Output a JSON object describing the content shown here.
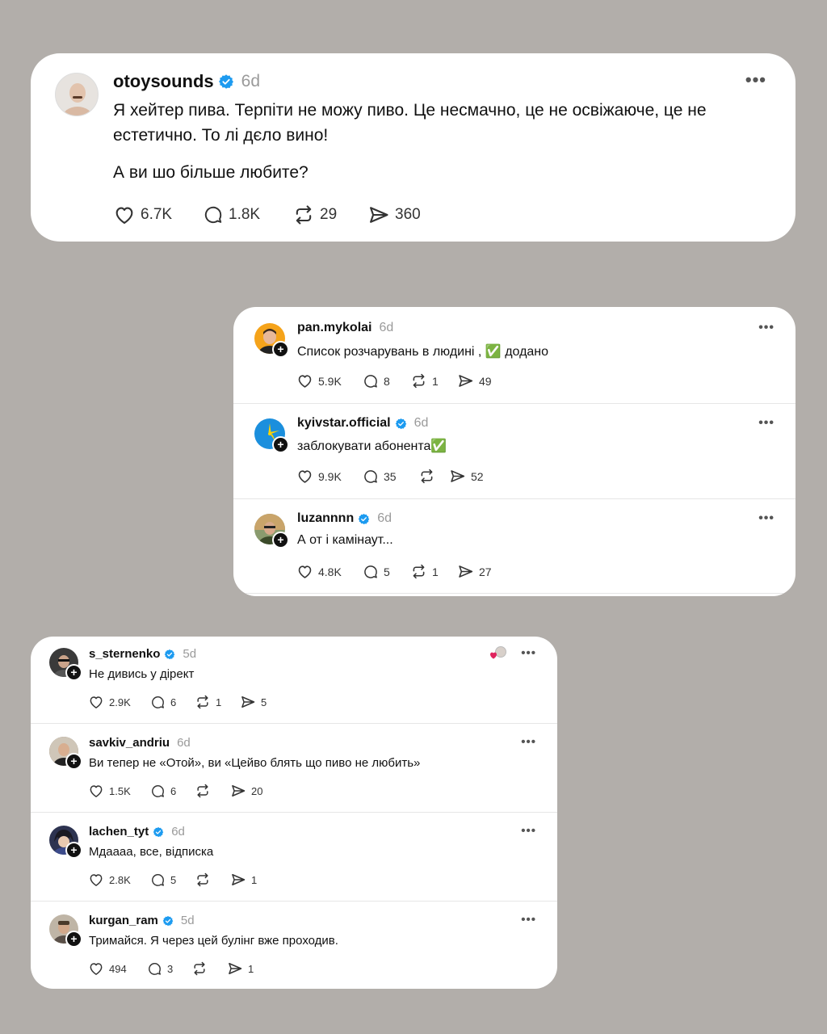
{
  "main_post": {
    "username": "otoysounds",
    "time": "6d",
    "text_line1": "Я хейтер пива. Терпіти не можу пиво. Це несмачно, це не освіжаюче, це не",
    "text_line2": "естетично. То лі дєло вино!",
    "text_line3": "А ви шо більше любите?",
    "likes": "6.7K",
    "replies": "1.8K",
    "reposts": "29",
    "shares": "360",
    "verified": true
  },
  "replies_block_1": [
    {
      "username": "pan.mykolai",
      "verified": false,
      "time": "6d",
      "text": "Список розчарувань в людині , ✅ додано",
      "likes": "5.9K",
      "replies": "8",
      "reposts": "1",
      "shares": "49"
    },
    {
      "username": "kyivstar.official",
      "verified": true,
      "time": "6d",
      "text": "заблокувати абонента✅",
      "likes": "9.9K",
      "replies": "35",
      "reposts": "",
      "shares": "52"
    },
    {
      "username": "luzannnn",
      "verified": true,
      "time": "6d",
      "text": "А от і камінаут...",
      "likes": "4.8K",
      "replies": "5",
      "reposts": "1",
      "shares": "27"
    }
  ],
  "replies_block_2": [
    {
      "username": "s_sternenko",
      "verified": true,
      "time": "5d",
      "text": "Не дивись у дірект",
      "likes": "2.9K",
      "replies": "6",
      "reposts": "1",
      "shares": "5"
    },
    {
      "username": "savkiv_andriu",
      "verified": false,
      "time": "6d",
      "text": "Ви тепер не «Отой», ви «Цейво блять що пиво не любить»",
      "likes": "1.5K",
      "replies": "6",
      "reposts": "",
      "shares": "20"
    },
    {
      "username": "lachen_tyt",
      "verified": true,
      "time": "6d",
      "text": "Мдаааа, все, відписка",
      "likes": "2.8K",
      "replies": "5",
      "reposts": "",
      "shares": "1"
    },
    {
      "username": "kurgan_ram",
      "verified": true,
      "time": "5d",
      "text": "Тримайся. Я через цей булінг вже проходив.",
      "likes": "494",
      "replies": "3",
      "reposts": "",
      "shares": "1"
    }
  ],
  "colors": {
    "background": "#b2aeaa",
    "verified_blue": "#1d9bf0",
    "kyivstar_blue": "#1b8fdd",
    "like_heart": "#e0245e"
  }
}
